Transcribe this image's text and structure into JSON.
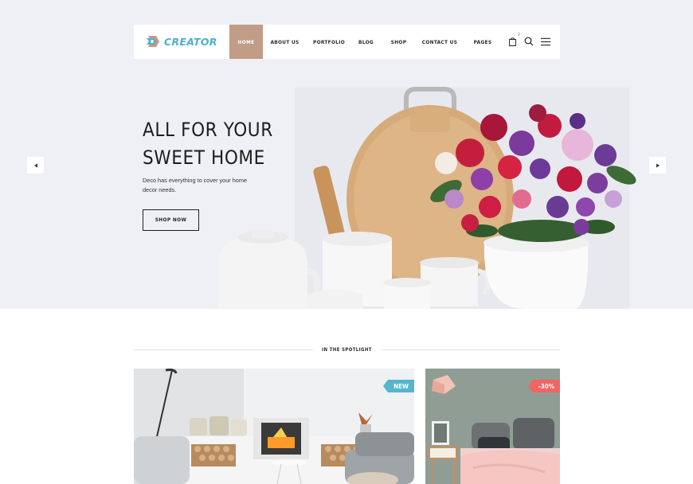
{
  "header": {
    "logo_text": "CREATOR",
    "nav": [
      {
        "label": "HOME",
        "active": true
      },
      {
        "label": "ABOUT US",
        "active": false
      },
      {
        "label": "PORTFOLIO",
        "active": false
      },
      {
        "label": "BLOG",
        "active": false
      },
      {
        "label": "SHOP",
        "active": false
      },
      {
        "label": "CONTACT US",
        "active": false
      },
      {
        "label": "PAGES",
        "active": false
      }
    ],
    "cart_count": "2",
    "icons": [
      "cart-icon",
      "search-icon",
      "menu-icon"
    ]
  },
  "hero": {
    "title_line1": "ALL FOR YOUR",
    "title_line2": "SWEET HOME",
    "description": "Deco has everything to cover your home decor needs.",
    "cta_label": "SHOP NOW",
    "prev_icon": "arrow-left-icon",
    "next_icon": "arrow-right-icon"
  },
  "spotlight": {
    "heading": "IN THE SPOTLIGHT",
    "cards": [
      {
        "badge": "NEW",
        "image": "living-room-fireplace"
      },
      {
        "badge": "-30%",
        "image": "bedroom-pink-blanket"
      }
    ]
  },
  "colors": {
    "accent": "#c19c86",
    "logo": "#4fb0c6",
    "badge_new": "#57b5cc",
    "badge_sale": "#ef6663",
    "hero_bg": "#eff0f5"
  }
}
